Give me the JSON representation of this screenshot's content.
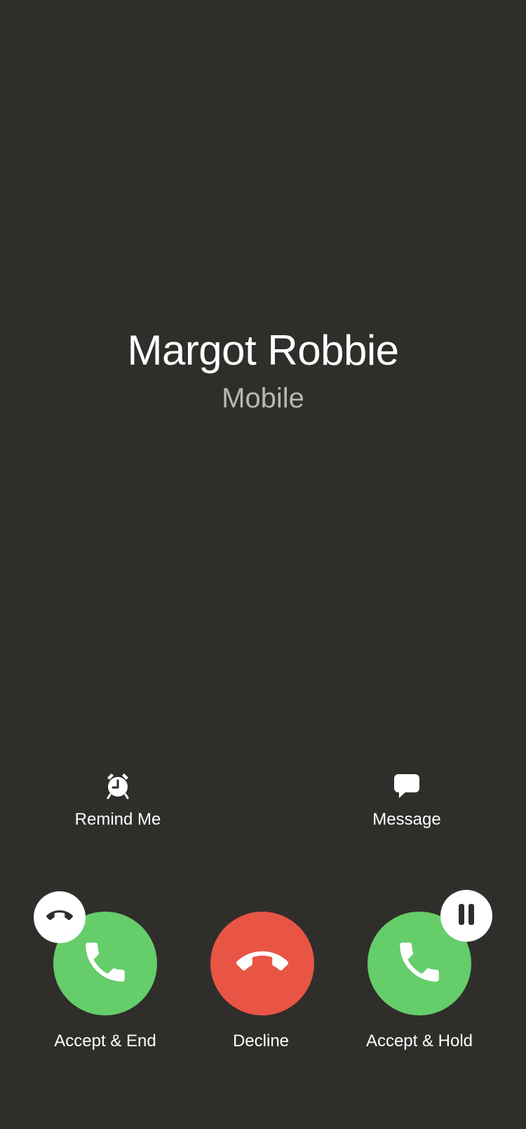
{
  "caller": {
    "name": "Margot Robbie",
    "label": "Mobile"
  },
  "secondary_actions": {
    "remind_me": {
      "label": "Remind Me",
      "icon": "alarm-clock-icon"
    },
    "message": {
      "label": "Message",
      "icon": "message-bubble-icon"
    }
  },
  "call_actions": {
    "accept_end": {
      "label": "Accept & End",
      "icon": "phone-icon",
      "badge_icon": "end-call-icon"
    },
    "decline": {
      "label": "Decline",
      "icon": "end-call-icon"
    },
    "accept_hold": {
      "label": "Accept & Hold",
      "icon": "phone-icon",
      "badge_icon": "pause-icon"
    }
  },
  "colors": {
    "background": "#302e2b",
    "accept": "#65cd6a",
    "decline": "#e95545",
    "secondary_text": "#b9b7b3"
  }
}
